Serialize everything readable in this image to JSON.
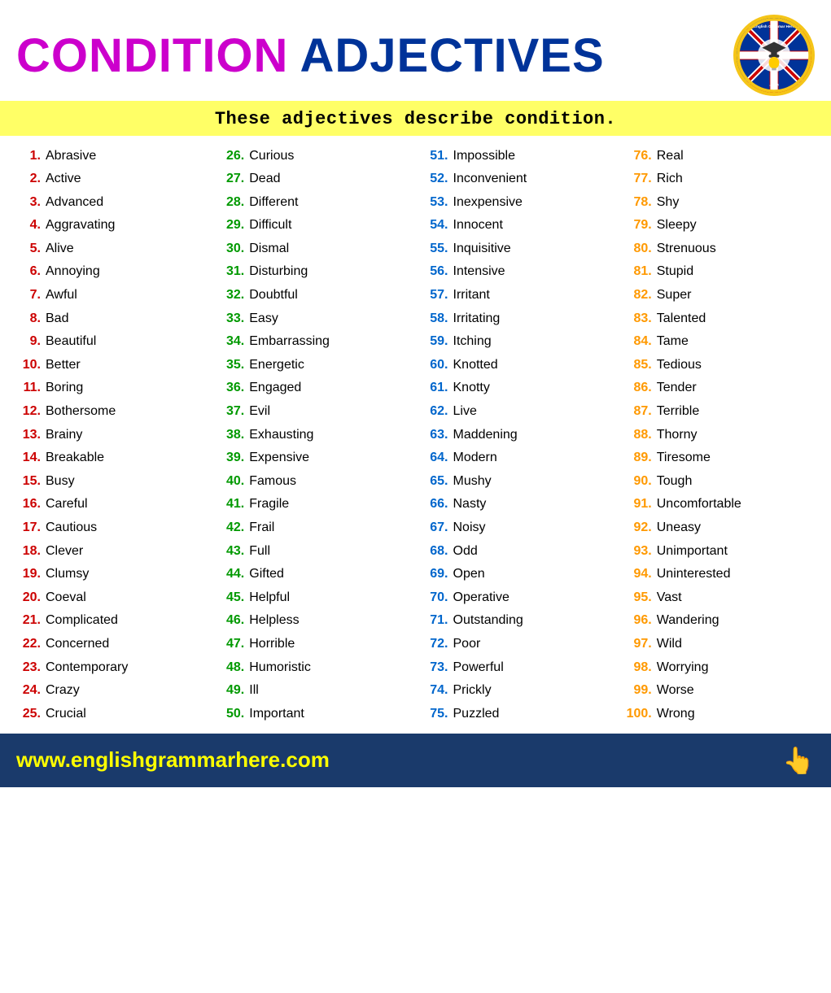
{
  "header": {
    "title_condition": "CONDITION",
    "title_adjectives": "ADJECTIVES",
    "subtitle": "These adjectives describe condition."
  },
  "footer": {
    "url": "www.englishgrammarhere.com"
  },
  "columns": [
    {
      "id": "col1",
      "items": [
        {
          "num": "1.",
          "word": "Abrasive"
        },
        {
          "num": "2.",
          "word": "Active"
        },
        {
          "num": "3.",
          "word": "Advanced"
        },
        {
          "num": "4.",
          "word": "Aggravating"
        },
        {
          "num": "5.",
          "word": "Alive"
        },
        {
          "num": "6.",
          "word": "Annoying"
        },
        {
          "num": "7.",
          "word": "Awful"
        },
        {
          "num": "8.",
          "word": "Bad"
        },
        {
          "num": "9.",
          "word": "Beautiful"
        },
        {
          "num": "10.",
          "word": "Better"
        },
        {
          "num": "11.",
          "word": "Boring"
        },
        {
          "num": "12.",
          "word": "Bothersome"
        },
        {
          "num": "13.",
          "word": "Brainy"
        },
        {
          "num": "14.",
          "word": "Breakable"
        },
        {
          "num": "15.",
          "word": "Busy"
        },
        {
          "num": "16.",
          "word": "Careful"
        },
        {
          "num": "17.",
          "word": "Cautious"
        },
        {
          "num": "18.",
          "word": "Clever"
        },
        {
          "num": "19.",
          "word": "Clumsy"
        },
        {
          "num": "20.",
          "word": "Coeval"
        },
        {
          "num": "21.",
          "word": "Complicated"
        },
        {
          "num": "22.",
          "word": "Concerned"
        },
        {
          "num": "23.",
          "word": "Contemporary"
        },
        {
          "num": "24.",
          "word": "Crazy"
        },
        {
          "num": "25.",
          "word": "Crucial"
        }
      ]
    },
    {
      "id": "col2",
      "items": [
        {
          "num": "26.",
          "word": "Curious"
        },
        {
          "num": "27.",
          "word": "Dead"
        },
        {
          "num": "28.",
          "word": "Different"
        },
        {
          "num": "29.",
          "word": "Difficult"
        },
        {
          "num": "30.",
          "word": "Dismal"
        },
        {
          "num": "31.",
          "word": "Disturbing"
        },
        {
          "num": "32.",
          "word": "Doubtful"
        },
        {
          "num": "33.",
          "word": "Easy"
        },
        {
          "num": "34.",
          "word": "Embarrassing"
        },
        {
          "num": "35.",
          "word": "Energetic"
        },
        {
          "num": "36.",
          "word": "Engaged"
        },
        {
          "num": "37.",
          "word": "Evil"
        },
        {
          "num": "38.",
          "word": "Exhausting"
        },
        {
          "num": "39.",
          "word": "Expensive"
        },
        {
          "num": "40.",
          "word": "Famous"
        },
        {
          "num": "41.",
          "word": "Fragile"
        },
        {
          "num": "42.",
          "word": "Frail"
        },
        {
          "num": "43.",
          "word": "Full"
        },
        {
          "num": "44.",
          "word": "Gifted"
        },
        {
          "num": "45.",
          "word": "Helpful"
        },
        {
          "num": "46.",
          "word": "Helpless"
        },
        {
          "num": "47.",
          "word": "Horrible"
        },
        {
          "num": "48.",
          "word": "Humoristic"
        },
        {
          "num": "49.",
          "word": "Ill"
        },
        {
          "num": "50.",
          "word": "Important"
        }
      ]
    },
    {
      "id": "col3",
      "items": [
        {
          "num": "51.",
          "word": "Impossible"
        },
        {
          "num": "52.",
          "word": "Inconvenient"
        },
        {
          "num": "53.",
          "word": "Inexpensive"
        },
        {
          "num": "54.",
          "word": "Innocent"
        },
        {
          "num": "55.",
          "word": "Inquisitive"
        },
        {
          "num": "56.",
          "word": "Intensive"
        },
        {
          "num": "57.",
          "word": "Irritant"
        },
        {
          "num": "58.",
          "word": "Irritating"
        },
        {
          "num": "59.",
          "word": " Itching"
        },
        {
          "num": "60.",
          "word": "Knotted"
        },
        {
          "num": "61.",
          "word": "Knotty"
        },
        {
          "num": "62.",
          "word": "Live"
        },
        {
          "num": "63.",
          "word": "Maddening"
        },
        {
          "num": "64.",
          "word": "Modern"
        },
        {
          "num": "65.",
          "word": "Mushy"
        },
        {
          "num": "66.",
          "word": "Nasty"
        },
        {
          "num": "67.",
          "word": "Noisy"
        },
        {
          "num": "68.",
          "word": "Odd"
        },
        {
          "num": "69.",
          "word": "Open"
        },
        {
          "num": "70.",
          "word": "Operative"
        },
        {
          "num": "71.",
          "word": "Outstanding"
        },
        {
          "num": "72.",
          "word": "Poor"
        },
        {
          "num": "73.",
          "word": "Powerful"
        },
        {
          "num": "74.",
          "word": "Prickly"
        },
        {
          "num": "75.",
          "word": "Puzzled"
        }
      ]
    },
    {
      "id": "col4",
      "items": [
        {
          "num": "76.",
          "word": "Real"
        },
        {
          "num": "77.",
          "word": "Rich"
        },
        {
          "num": "78.",
          "word": "Shy"
        },
        {
          "num": "79.",
          "word": "Sleepy"
        },
        {
          "num": "80.",
          "word": "Strenuous"
        },
        {
          "num": "81.",
          "word": "Stupid"
        },
        {
          "num": "82.",
          "word": "Super"
        },
        {
          "num": "83.",
          "word": "Talented"
        },
        {
          "num": "84.",
          "word": "Tame"
        },
        {
          "num": "85.",
          "word": "Tedious"
        },
        {
          "num": "86.",
          "word": "Tender"
        },
        {
          "num": "87.",
          "word": "Terrible"
        },
        {
          "num": "88.",
          "word": "Thorny"
        },
        {
          "num": "89.",
          "word": "Tiresome"
        },
        {
          "num": "90.",
          "word": "Tough"
        },
        {
          "num": "91.",
          "word": "Uncomfortable"
        },
        {
          "num": "92.",
          "word": "Uneasy"
        },
        {
          "num": "93.",
          "word": "Unimportant"
        },
        {
          "num": "94.",
          "word": "Uninterested"
        },
        {
          "num": "95.",
          "word": "Vast"
        },
        {
          "num": "96.",
          "word": "Wandering"
        },
        {
          "num": "97.",
          "word": "Wild"
        },
        {
          "num": "98.",
          "word": "Worrying"
        },
        {
          "num": "99.",
          "word": "Worse"
        },
        {
          "num": "100.",
          "word": "Wrong"
        }
      ]
    }
  ]
}
